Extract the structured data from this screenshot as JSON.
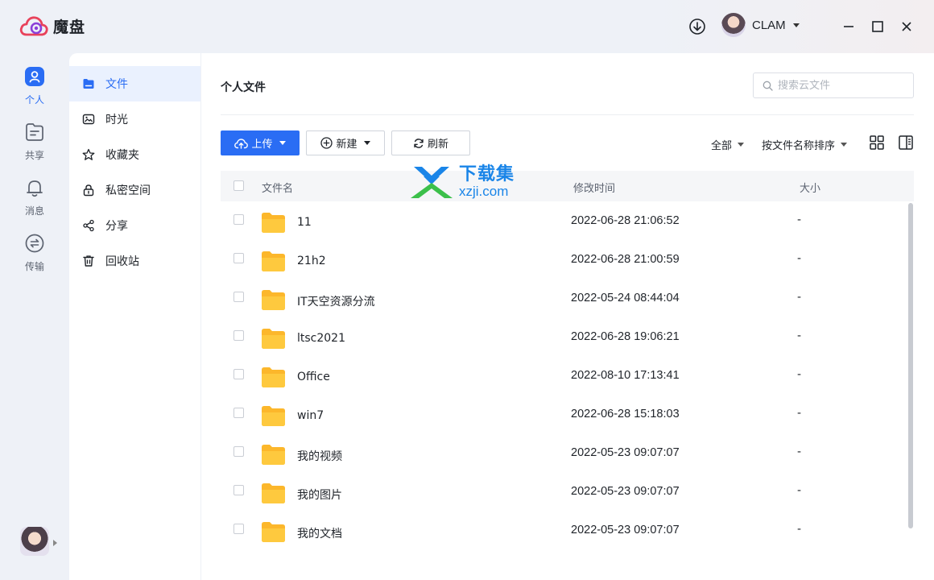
{
  "app": {
    "name": "魔盘",
    "brand_color": "#2a6df4"
  },
  "titlebar": {
    "user_name": "CLAM"
  },
  "nav": [
    {
      "label": "个人",
      "icon": "person-icon",
      "active": true
    },
    {
      "label": "共享",
      "icon": "share-folder-icon"
    },
    {
      "label": "消息",
      "icon": "bell-icon"
    },
    {
      "label": "传输",
      "icon": "transfer-icon"
    }
  ],
  "sidebar": [
    {
      "label": "文件",
      "icon": "folder-icon",
      "active": true
    },
    {
      "label": "时光",
      "icon": "photo-icon"
    },
    {
      "label": "收藏夹",
      "icon": "star-icon"
    },
    {
      "label": "私密空间",
      "icon": "lock-icon"
    },
    {
      "label": "分享",
      "icon": "share-icon"
    },
    {
      "label": "回收站",
      "icon": "trash-icon"
    }
  ],
  "main": {
    "title": "个人文件",
    "search_placeholder": "搜索云文件",
    "toolbar": {
      "upload": "上传",
      "new": "新建",
      "refresh": "刷新"
    },
    "filter": "全部",
    "sort": "按文件名称排序",
    "columns": {
      "name": "文件名",
      "modified": "修改时间",
      "size": "大小"
    },
    "files": [
      {
        "name": "11",
        "modified": "2022-06-28 21:06:52",
        "size": "-"
      },
      {
        "name": "21h2",
        "modified": "2022-06-28 21:00:59",
        "size": "-"
      },
      {
        "name": "IT天空资源分流",
        "modified": "2022-05-24 08:44:04",
        "size": "-"
      },
      {
        "name": "ltsc2021",
        "modified": "2022-06-28 19:06:21",
        "size": "-"
      },
      {
        "name": "Office",
        "modified": "2022-08-10 17:13:41",
        "size": "-"
      },
      {
        "name": "win7",
        "modified": "2022-06-28 15:18:03",
        "size": "-"
      },
      {
        "name": "我的视频",
        "modified": "2022-05-23 09:07:07",
        "size": "-"
      },
      {
        "name": "我的图片",
        "modified": "2022-05-23 09:07:07",
        "size": "-"
      },
      {
        "name": "我的文档",
        "modified": "2022-05-23 09:07:07",
        "size": "-"
      }
    ]
  },
  "watermark": {
    "cn": "下载集",
    "en": "xzji.com"
  }
}
